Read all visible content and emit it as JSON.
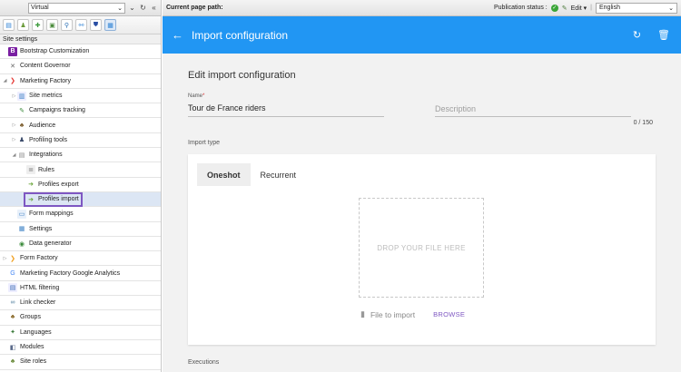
{
  "sidebar": {
    "site_select_value": "Virtual",
    "section_label": "Site settings",
    "items": [
      {
        "label": "Bootstrap Customization",
        "icon": "bootstrap-icon",
        "indent": 0,
        "toggle": ""
      },
      {
        "label": "Content Governor",
        "icon": "wrench-icon",
        "indent": 0,
        "toggle": ""
      },
      {
        "label": "Marketing Factory",
        "icon": "marketing-factory-icon",
        "indent": 0,
        "toggle": "expanded"
      },
      {
        "label": "Site metrics",
        "icon": "chart-icon",
        "indent": 1,
        "toggle": "collapsed"
      },
      {
        "label": "Campaigns tracking",
        "icon": "pencil-icon",
        "indent": 1,
        "toggle": ""
      },
      {
        "label": "Audience",
        "icon": "audience-icon",
        "indent": 1,
        "toggle": "collapsed"
      },
      {
        "label": "Profiling tools",
        "icon": "user-icon",
        "indent": 1,
        "toggle": "collapsed"
      },
      {
        "label": "Integrations",
        "icon": "document-icon",
        "indent": 1,
        "toggle": "expanded"
      },
      {
        "label": "Rules",
        "icon": "list-icon",
        "indent": 2,
        "toggle": ""
      },
      {
        "label": "Profiles export",
        "icon": "export-icon",
        "indent": 2,
        "toggle": ""
      },
      {
        "label": "Profiles import",
        "icon": "import-icon",
        "indent": 2,
        "toggle": "",
        "selected": true
      },
      {
        "label": "Form mappings",
        "icon": "form-icon",
        "indent": 1,
        "toggle": ""
      },
      {
        "label": "Settings",
        "icon": "settings-icon",
        "indent": 1,
        "toggle": ""
      },
      {
        "label": "Data generator",
        "icon": "globe-icon",
        "indent": 1,
        "toggle": ""
      },
      {
        "label": "Form Factory",
        "icon": "form-factory-icon",
        "indent": 0,
        "toggle": "collapsed"
      },
      {
        "label": "Marketing Factory Google Analytics",
        "icon": "google-icon",
        "indent": 0,
        "toggle": ""
      },
      {
        "label": "HTML filtering",
        "icon": "html-icon",
        "indent": 0,
        "toggle": ""
      },
      {
        "label": "Link checker",
        "icon": "link-icon",
        "indent": 0,
        "toggle": ""
      },
      {
        "label": "Groups",
        "icon": "groups-icon",
        "indent": 0,
        "toggle": ""
      },
      {
        "label": "Languages",
        "icon": "languages-icon",
        "indent": 0,
        "toggle": ""
      },
      {
        "label": "Modules",
        "icon": "modules-icon",
        "indent": 0,
        "toggle": ""
      },
      {
        "label": "Site roles",
        "icon": "roles-icon",
        "indent": 0,
        "toggle": ""
      }
    ]
  },
  "header": {
    "current_path_label": "Current page path:",
    "publication_status_label": "Publication status :",
    "edit_label": "Edit",
    "language_value": "English"
  },
  "appbar": {
    "title": "Import configuration"
  },
  "form": {
    "heading": "Edit import configuration",
    "name_label": "Name",
    "name_required_mark": "*",
    "name_value": "Tour de France riders",
    "description_placeholder": "Description",
    "counter": "0 / 150",
    "import_type_label": "Import type",
    "tabs": [
      "Oneshot",
      "Recurrent"
    ],
    "active_tab": 0,
    "dropzone_text": "DROP YOUR FILE HERE",
    "file_label": "File to import",
    "browse_label": "BROWSE",
    "executions_label": "Executions"
  },
  "colors": {
    "appbar_bg": "#2196f3",
    "accent_purple": "#7e57c2",
    "status_green": "#3aa537"
  }
}
